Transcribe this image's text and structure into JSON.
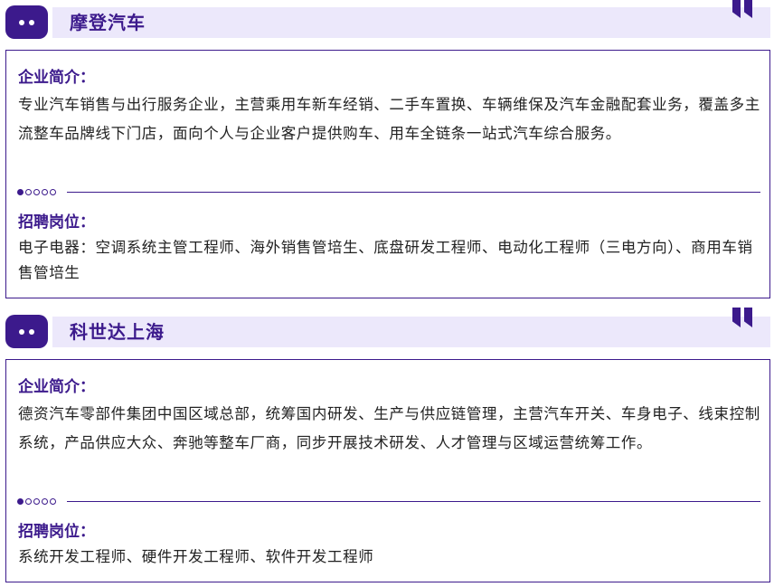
{
  "companies": [
    {
      "name": "摩登汽车",
      "intro_label": "企业简介：",
      "intro": "专业汽车销售与出行服务企业，主营乘用车新车经销、二手车置换、车辆维保及汽车金融配套业务，覆盖多主流整车品牌线下门店，面向个人与企业客户提供购车、用车全链条一站式汽车综合服务。",
      "jobs_label": "招聘岗位：",
      "jobs": "电子电器：空调系统主管工程师、海外销售管培生、底盘研发工程师、电动化工程师（三电方向）、商用车销售管培生"
    },
    {
      "name": "科世达上海",
      "intro_label": "企业简介：",
      "intro": "德资汽车零部件集团中国区域总部，统筹国内研发、生产与供应链管理，主营汽车开关、车身电子、线束控制系统，产品供应大众、奔驰等整车厂商，同步开展技术研发、人才管理与区域运营统筹工作。",
      "jobs_label": "招聘岗位：",
      "jobs": "系统开发工程师、硬件开发工程师、软件开发工程师"
    }
  ],
  "colors": {
    "accent": "#3c1a8c",
    "header_bg": "#ece8fb",
    "text": "#222222"
  },
  "icons": {
    "badge": "two-dots-icon",
    "corner": "quote-mark-icon",
    "divider": "dots-indicator-icon"
  }
}
